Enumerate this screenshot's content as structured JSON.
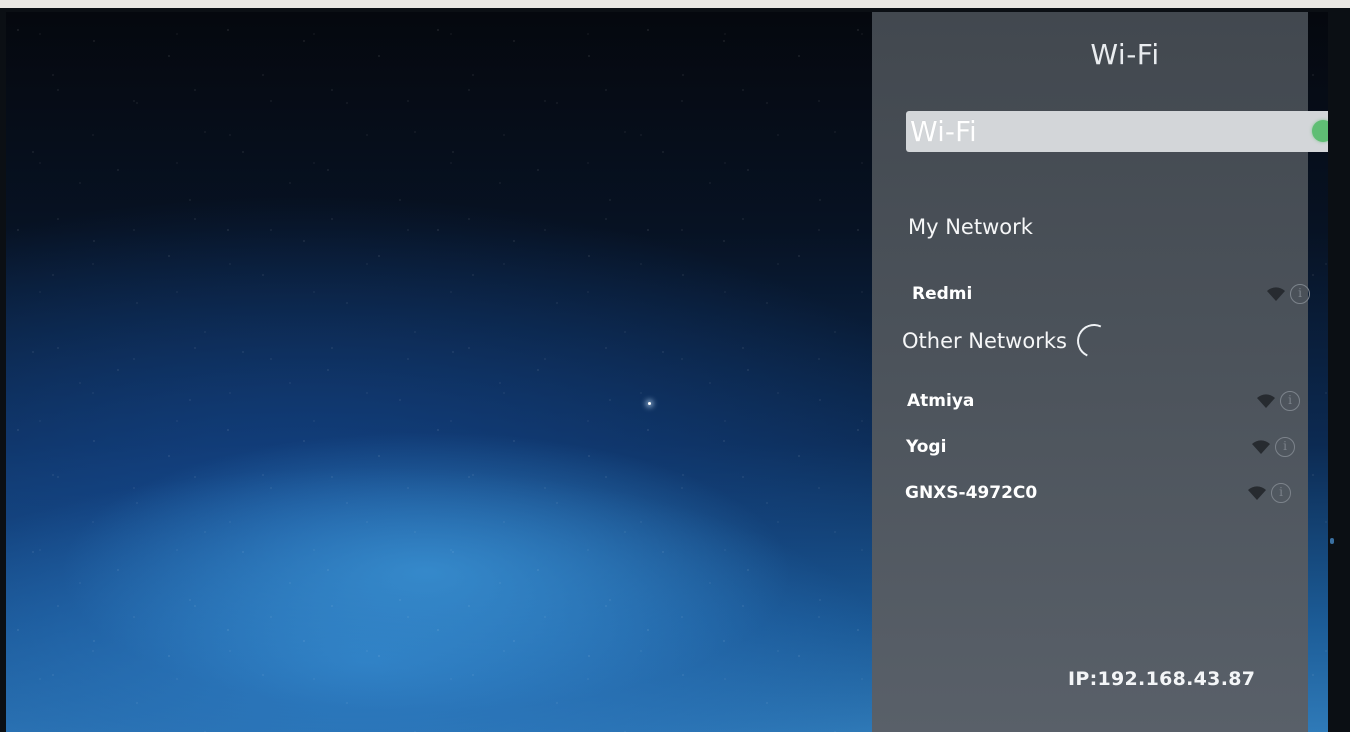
{
  "panel": {
    "title": "Wi-Fi",
    "toggle": {
      "label": "Wi-Fi",
      "enabled": true,
      "on_color": "#5fbe74"
    },
    "my_network": {
      "heading": "My Network",
      "items": [
        {
          "name": "Redmi",
          "signal_icon": "wifi-icon",
          "info_icon": "info-icon"
        }
      ]
    },
    "other_networks": {
      "heading": "Other Networks",
      "loading": true,
      "items": [
        {
          "name": "Atmiya",
          "signal_icon": "wifi-icon",
          "info_icon": "info-icon"
        },
        {
          "name": "Yogi",
          "signal_icon": "wifi-icon",
          "info_icon": "info-icon"
        },
        {
          "name": "GNXS-4972C0",
          "signal_icon": "wifi-icon",
          "info_icon": "info-icon"
        }
      ]
    },
    "ip": "IP:192.168.43.87",
    "info_glyph": "i"
  },
  "colors": {
    "panel_bg": "#4b525a",
    "toggle_bar": "#d3d6d9",
    "text": "#ffffff"
  }
}
